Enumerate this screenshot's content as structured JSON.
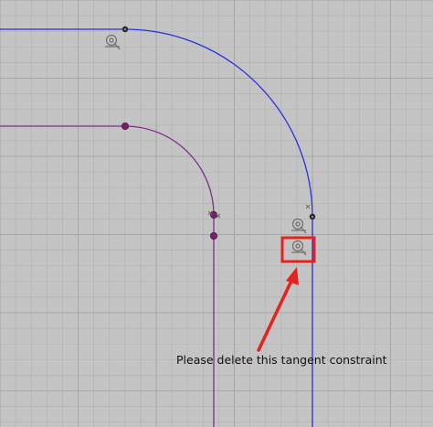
{
  "annotation": {
    "text": "Please delete this tangent constraint",
    "highlight_color": "#e8201e"
  },
  "colors": {
    "background": "#c4c4c4",
    "grid_minor": "#b4b4b4",
    "grid_major": "#a6a6a6",
    "blue_curve": "#2b2fe0",
    "purple_curve": "#7a2f8a",
    "point_fill": "#7a1e6e",
    "constraint_icon": "#6e6e6e"
  },
  "icons": {
    "constraint": "tangent-constraint-icon",
    "arrow": "annotation-arrow-icon"
  }
}
